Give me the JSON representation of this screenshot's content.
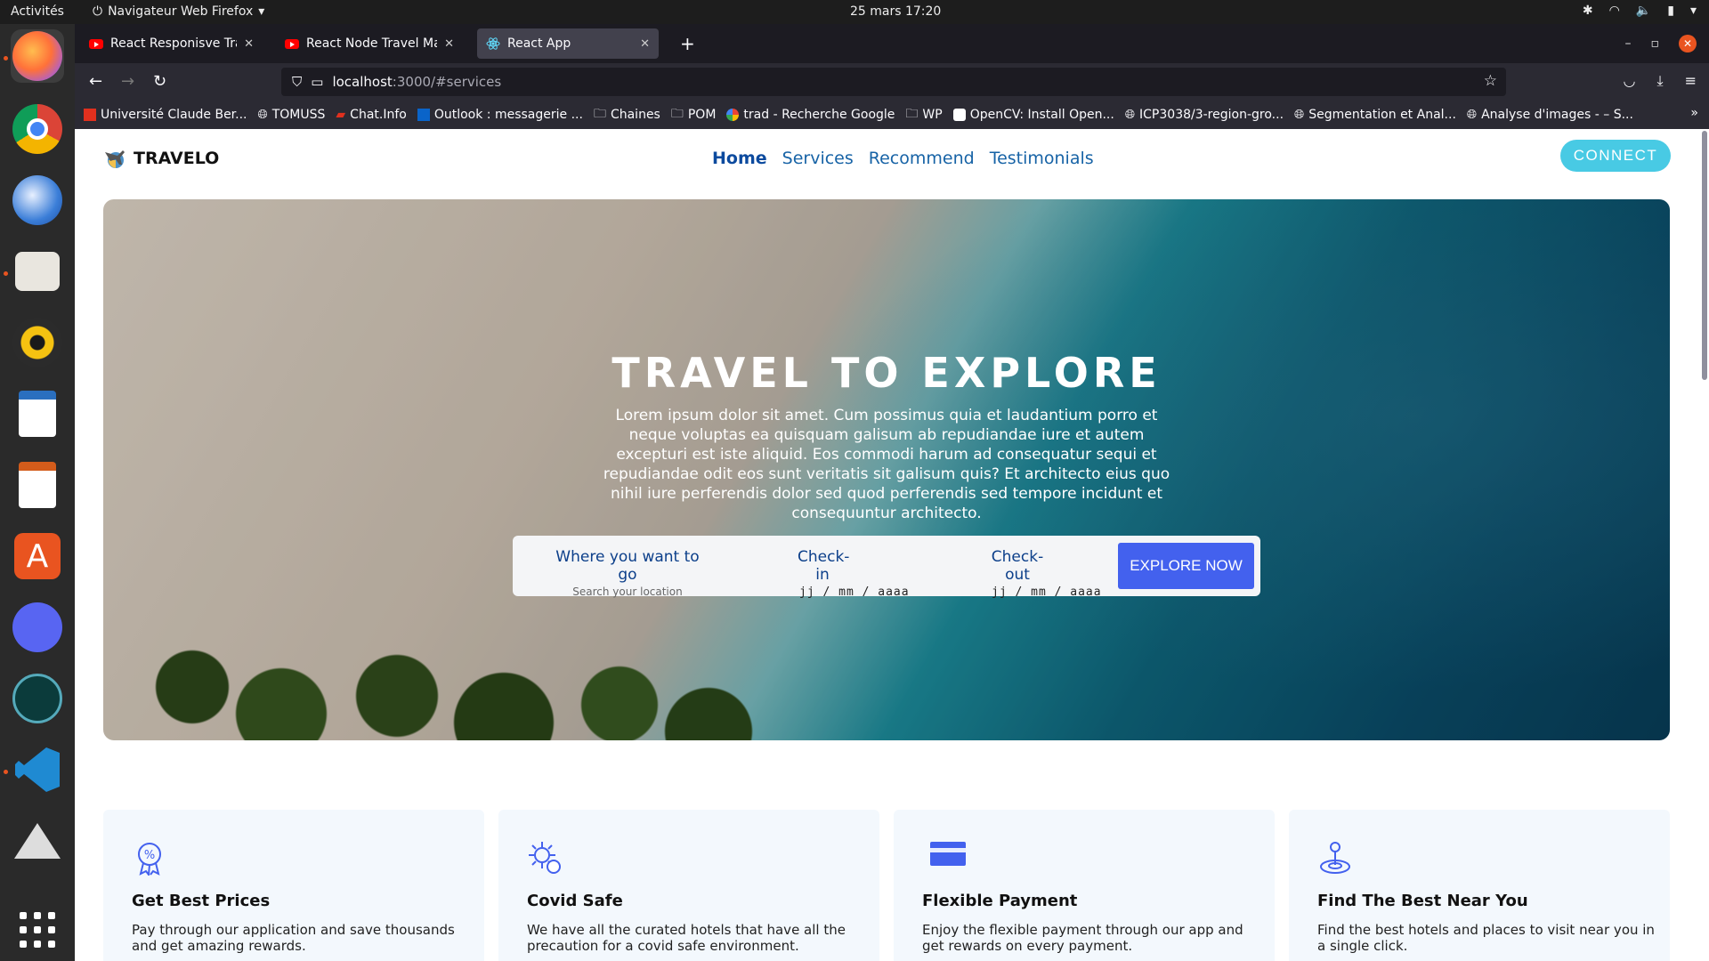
{
  "system": {
    "activities": "Activités",
    "app_menu": "Navigateur Web Firefox",
    "clock": "25 mars  17:20"
  },
  "browser": {
    "tabs": [
      {
        "title": "React Responisve Travel ·",
        "icon": "youtube-icon",
        "active": false
      },
      {
        "title": "React Node Travel Map A",
        "icon": "youtube-icon",
        "active": false
      },
      {
        "title": "React App",
        "icon": "react-icon",
        "active": true
      }
    ],
    "url_host": "localhost",
    "url_rest": ":3000/#services",
    "bookmarks": [
      "Université Claude Ber...",
      "TOMUSS",
      "Chat.Info",
      "Outlook : messagerie ...",
      "Chaines",
      "POM",
      "trad - Recherche Google",
      "WP",
      "OpenCV: Install Open...",
      "ICP3038/3-region-gro...",
      "Segmentation et Anal...",
      "Analyse d'images - – S..."
    ]
  },
  "site": {
    "brand": "TRAVELO",
    "nav": [
      "Home",
      "Services",
      "Recommend",
      "Testimonials"
    ],
    "connect": "CONNECT",
    "hero": {
      "title": "TRAVEL TO EXPLORE",
      "text": "Lorem ipsum dolor sit amet. Cum possimus quia et laudantium porro et neque voluptas ea quisquam galisum ab repudiandae iure et autem excepturi est iste aliquid. Eos commodi harum ad consequatur sequi et repudiandae odit eos sunt veritatis sit galisum quis? Et architecto eius quo nihil iure perferendis dolor sed quod perferendis sed tempore incidunt et consequuntur architecto."
    },
    "search": {
      "location_label": "Where you want to go",
      "location_placeholder": "Search your location",
      "checkin_label": "Check-in",
      "checkin_value": "jj / mm / aaaa",
      "checkout_label": "Check-out",
      "checkout_value": "jj / mm / aaaa",
      "button": "EXPLORE NOW"
    },
    "services": [
      {
        "title": "Get Best Prices",
        "desc": "Pay through our application and save thousands and get amazing rewards.",
        "icon": "discount-badge-icon"
      },
      {
        "title": "Covid Safe",
        "desc": "We have all the curated hotels that have all the precaution for a covid safe environment.",
        "icon": "virus-shield-icon"
      },
      {
        "title": "Flexible Payment",
        "desc": "Enjoy the flexible payment through our app and get rewards on every payment.",
        "icon": "credit-card-icon"
      },
      {
        "title": "Find The Best Near You",
        "desc": "Find the best hotels and places to visit near you in a single click.",
        "icon": "location-pin-icon"
      }
    ]
  },
  "colors": {
    "accent": "#4361ee",
    "connect": "#48cae4",
    "nav_link": "#1763a6"
  }
}
